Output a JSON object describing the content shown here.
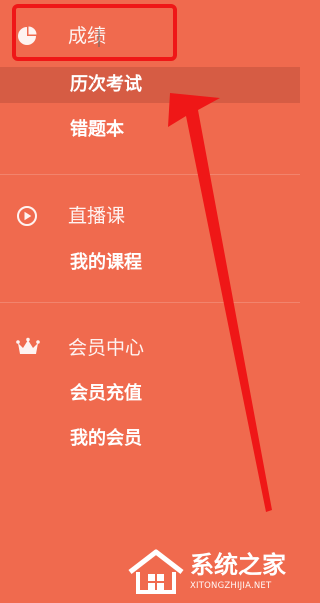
{
  "colors": {
    "background": "#f06a4e",
    "active_row": "#d65c44",
    "highlight": "#ef1717",
    "arrow": "#ef1717",
    "text": "#ffffff"
  },
  "menu": {
    "sections": [
      {
        "title": "成绩",
        "icon": "pie-chart-icon",
        "items": [
          {
            "label": "历次考试",
            "active": true
          },
          {
            "label": "错题本",
            "active": false
          }
        ]
      },
      {
        "title": "直播课",
        "icon": "play-circle-icon",
        "items": [
          {
            "label": "我的课程",
            "active": false
          }
        ]
      },
      {
        "title": "会员中心",
        "icon": "crown-icon",
        "items": [
          {
            "label": "会员充值",
            "active": false
          },
          {
            "label": "我的会员",
            "active": false
          }
        ]
      }
    ]
  },
  "watermark": {
    "title": "系统之家",
    "subtitle": "XITONGZHIJIA.NET"
  }
}
